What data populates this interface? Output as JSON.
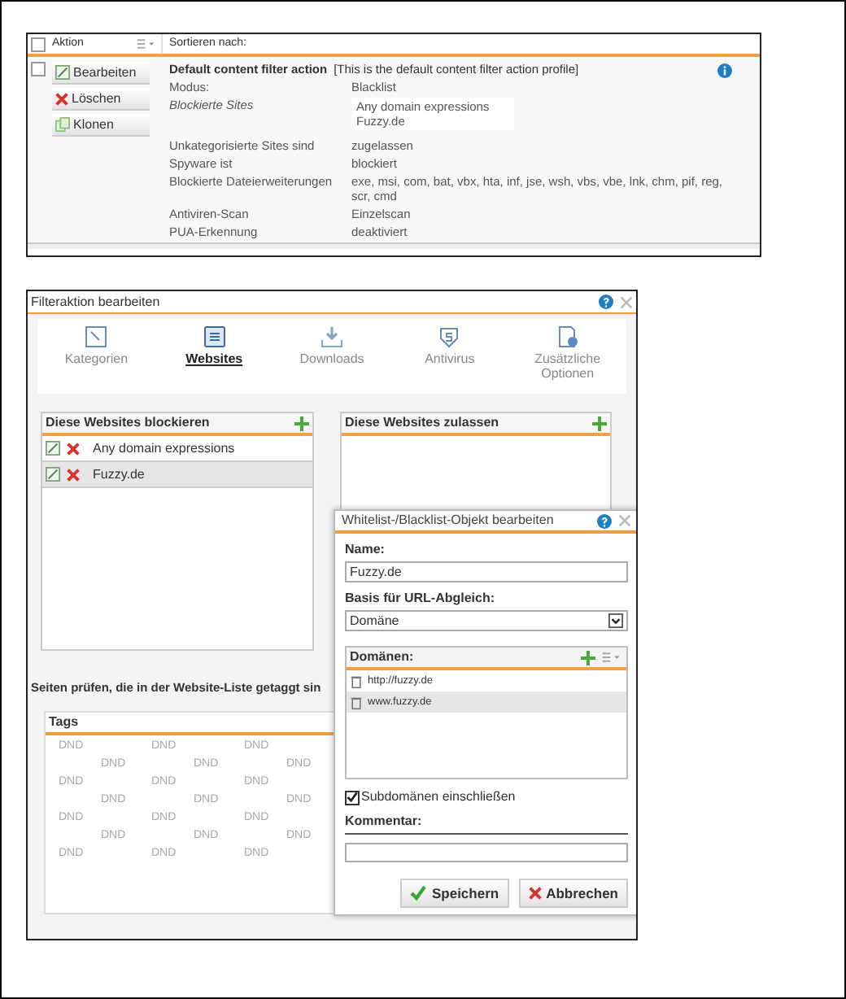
{
  "profile_list": {
    "header": {
      "checked": false,
      "action_label": "Aktion",
      "sort_label": "Sortieren nach:"
    },
    "row": {
      "checked": false,
      "buttons": [
        {
          "kind": "edit",
          "label": "Bearbeiten"
        },
        {
          "kind": "delete",
          "label": "Löschen"
        },
        {
          "kind": "clone",
          "label": "Klonen"
        }
      ],
      "title": "Default content filter action",
      "description": "[This is the default content filter action profile]",
      "fields": [
        {
          "kind": "text",
          "label": "Modus:",
          "value": "Blacklist"
        },
        {
          "kind": "list",
          "label": "Blockierte Sites",
          "values": [
            "Any domain expressions",
            "Fuzzy.de"
          ]
        },
        {
          "kind": "text",
          "label": "Unkategorisierte Sites sind",
          "value": "zugelassen"
        },
        {
          "kind": "text",
          "label": "Spyware ist",
          "value": "blockiert"
        },
        {
          "kind": "text",
          "label": "Blockierte Dateierweiterungen",
          "value": "exe, msi, com, bat, vbx, hta, inf, jse, wsh, vbs, vbe, lnk, chm, pif, reg, scr, cmd"
        },
        {
          "kind": "text",
          "label": "Antiviren-Scan",
          "value": "Einzelscan"
        },
        {
          "kind": "text",
          "label": "PUA-Erkennung",
          "value": "deaktiviert"
        }
      ]
    }
  },
  "dialog": {
    "title": "Filteraktion bearbeiten",
    "tabs": [
      {
        "kind": "categories",
        "label": "Kategorien",
        "selected": false
      },
      {
        "kind": "websites",
        "label": "Websites",
        "selected": true
      },
      {
        "kind": "downloads",
        "label": "Downloads",
        "selected": false
      },
      {
        "kind": "antivirus",
        "label": "Antivirus",
        "selected": false
      },
      {
        "kind": "options",
        "label": "Zusätzliche Optionen",
        "selected": false
      }
    ],
    "block_panel": {
      "title": "Diese Websites blockieren",
      "items": [
        {
          "label": "Any domain expressions",
          "selected": false
        },
        {
          "label": "Fuzzy.de",
          "selected": true
        }
      ]
    },
    "allow_panel": {
      "title": "Diese Websites zulassen"
    },
    "tag_hint": "Seiten prüfen, die in der Website-Liste getaggt sin",
    "tags_panel": {
      "title": "Tags",
      "rows": [
        [
          "DND",
          "DND",
          "DND"
        ],
        [
          "DND",
          "DND",
          "DND"
        ],
        [
          "DND",
          "DND",
          "DND"
        ],
        [
          "DND",
          "DND",
          "DND"
        ],
        [
          "DND",
          "DND",
          "DND"
        ],
        [
          "DND",
          "DND",
          "DND"
        ],
        [
          "DND",
          "DND",
          "DND"
        ]
      ]
    }
  },
  "object_dialog": {
    "title": "Whitelist-/Blacklist-Objekt bearbeiten",
    "name_label": "Name:",
    "name_value": "Fuzzy.de",
    "basis_label": "Basis für URL-Abgleich:",
    "basis_value": "Domäne",
    "domains_title": "Domänen:",
    "domains": [
      {
        "label": "http://fuzzy.de",
        "selected": false
      },
      {
        "label": "www.fuzzy.de",
        "selected": true
      }
    ],
    "subdomains": {
      "label": "Subdomänen einschließen",
      "checked": true
    },
    "comment_label": "Kommentar:",
    "buttons": [
      {
        "kind": "save",
        "label": "Speichern"
      },
      {
        "kind": "cancel",
        "label": "Abbrechen"
      }
    ]
  }
}
